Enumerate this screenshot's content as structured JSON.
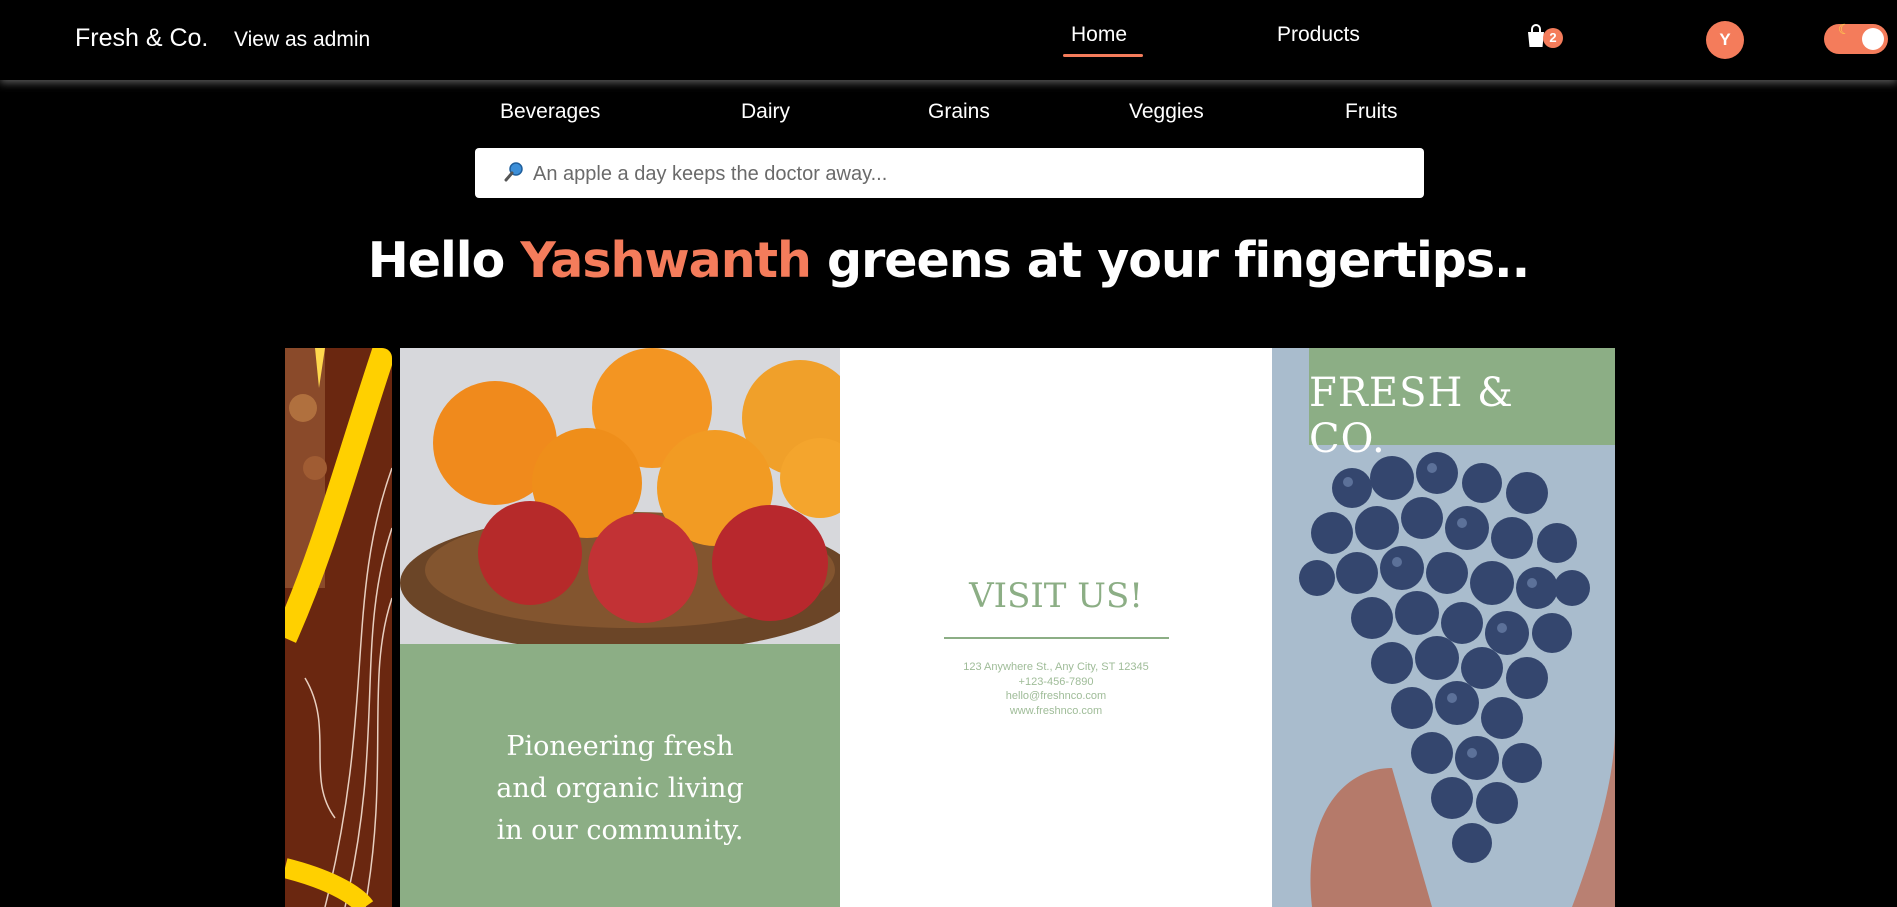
{
  "header": {
    "brand": "Fresh & Co.",
    "admin_link": "View as admin",
    "nav": {
      "home": "Home",
      "products": "Products"
    },
    "cart_count": "2",
    "avatar_initial": "Y"
  },
  "categories": [
    "Beverages",
    "Dairy",
    "Grains",
    "Veggies",
    "Fruits"
  ],
  "search": {
    "placeholder": "An apple a day keeps the doctor away..."
  },
  "hero": {
    "prefix": "Hello ",
    "name": "Yashwanth",
    "suffix": " greens at your fingertips.."
  },
  "banner": {
    "tagline_lines": [
      "Pioneering fresh",
      "and organic living",
      "in our community."
    ],
    "visit_title": "VISIT US!",
    "contact_lines": [
      "123 Anywhere St., Any City, ST 12345",
      "+123-456-7890",
      "hello@freshnco.com",
      "www.freshnco.com"
    ],
    "brand_title": "FRESH & CO."
  },
  "colors": {
    "accent": "#f47c5b",
    "sage": "#8cae85",
    "background": "#000000"
  },
  "icons": {
    "cart": "shopping-bag-icon",
    "search": "magnifier-icon",
    "theme": "moon-icon"
  }
}
